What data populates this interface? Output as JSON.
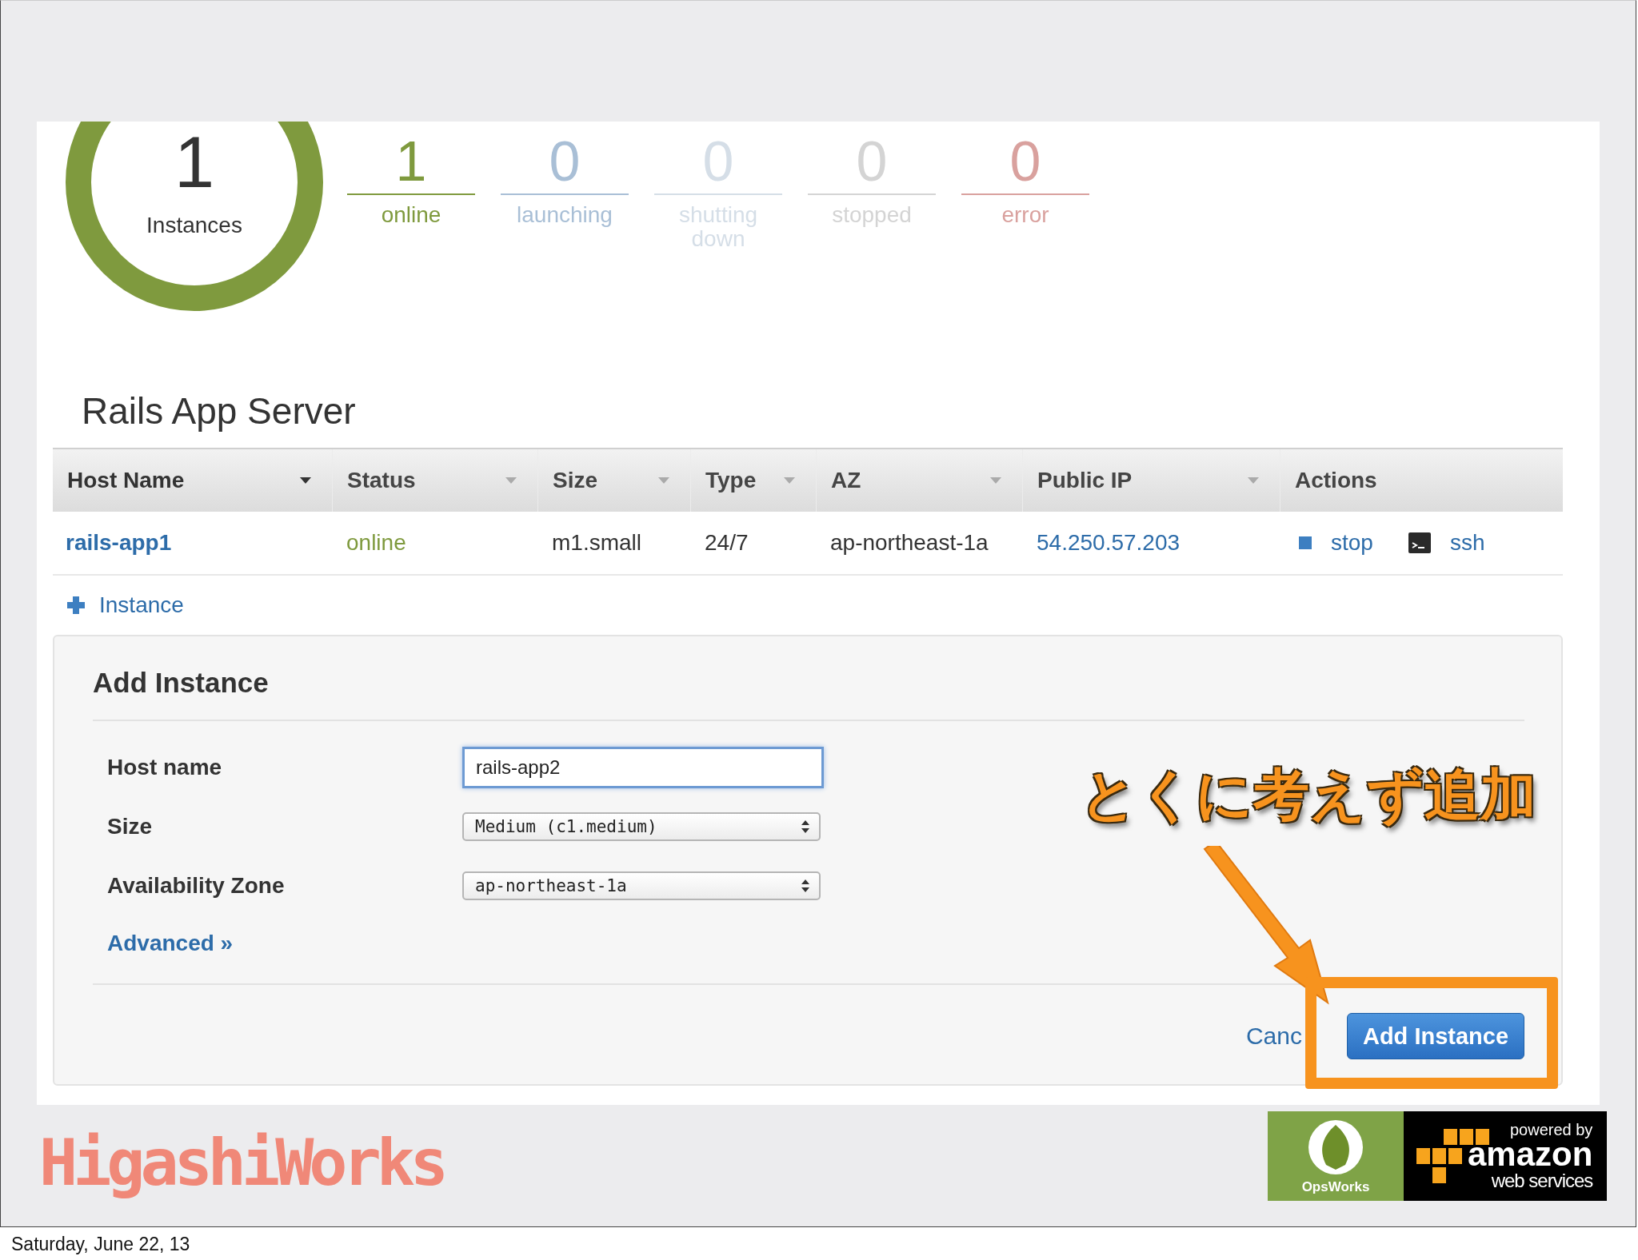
{
  "summary": {
    "total": "1",
    "total_label": "Instances",
    "counters": [
      {
        "count": "1",
        "label": "online",
        "color": "#7f9a3e"
      },
      {
        "count": "0",
        "label": "launching",
        "color": "#a9bfd6"
      },
      {
        "count": "0",
        "label": "shutting down",
        "color": "#d5dee7"
      },
      {
        "count": "0",
        "label": "stopped",
        "color": "#d4d4d4"
      },
      {
        "count": "0",
        "label": "error",
        "color": "#d9a19e"
      }
    ]
  },
  "layer": {
    "title": "Rails App Server"
  },
  "table": {
    "columns": [
      {
        "label": "Host Name",
        "sortable": true,
        "sorted": true
      },
      {
        "label": "Status",
        "sortable": true,
        "sorted": false
      },
      {
        "label": "Size",
        "sortable": true,
        "sorted": false
      },
      {
        "label": "Type",
        "sortable": true,
        "sorted": false
      },
      {
        "label": "AZ",
        "sortable": true,
        "sorted": false
      },
      {
        "label": "Public IP",
        "sortable": true,
        "sorted": false
      },
      {
        "label": "Actions",
        "sortable": false,
        "sorted": false
      }
    ],
    "rows": [
      {
        "host": "rails-app1",
        "status": "online",
        "size": "m1.small",
        "type": "24/7",
        "az": "ap-northeast-1a",
        "ip": "54.250.57.203",
        "actions": [
          {
            "kind": "stop",
            "label": "stop"
          },
          {
            "kind": "ssh",
            "label": "ssh"
          }
        ]
      }
    ]
  },
  "add_link": "Instance",
  "add_form": {
    "title": "Add Instance",
    "fields": [
      {
        "kind": "text",
        "label": "Host name",
        "value": "rails-app2",
        "focused": true
      },
      {
        "kind": "select",
        "label": "Size",
        "value": "Medium (c1.medium)"
      },
      {
        "kind": "select",
        "label": "Availability Zone",
        "value": "ap-northeast-1a"
      }
    ],
    "advanced": "Advanced »",
    "cancel": "Canc",
    "submit": "Add Instance"
  },
  "annotation": {
    "text": "とくに考えず追加"
  },
  "footer": {
    "brand": "HigashiWorks",
    "opsworks": "OpsWorks",
    "aws_powered": "powered by",
    "aws_name": "amazon",
    "aws_sub": "web services"
  },
  "date": "Saturday, June 22, 13"
}
